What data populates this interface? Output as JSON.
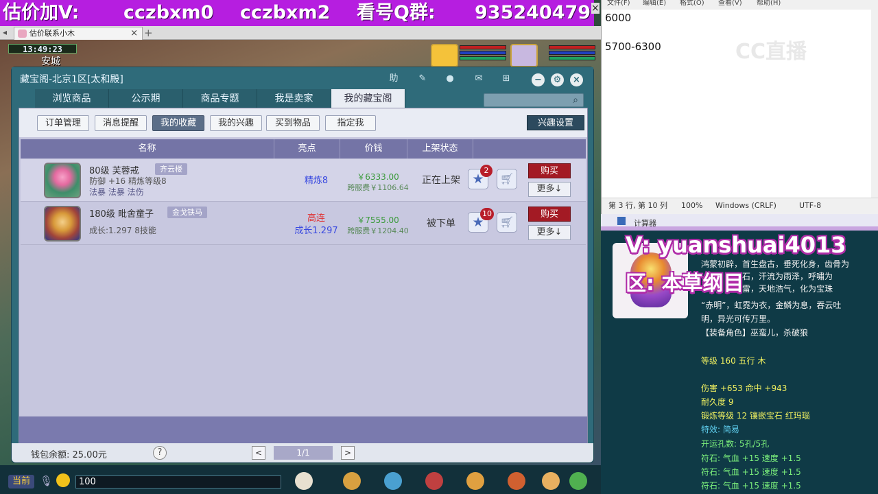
{
  "stream_banner": {
    "text_1": "估价加V:",
    "text_2": "cczbxm0",
    "text_3": "cczbxm2",
    "text_4": "看号Q群:",
    "text_5": "935240479",
    "close": "×"
  },
  "browser": {
    "tab_title": "估价联系小木",
    "tab_close": "×",
    "new_tab": "+"
  },
  "game_hud": {
    "time": "13:49:23",
    "city": "安城"
  },
  "shop": {
    "title": "藏宝阁-北京1区[太和殿]",
    "toolbar": {
      "help": "助"
    },
    "tabs": [
      {
        "label": "浏览商品"
      },
      {
        "label": "公示期"
      },
      {
        "label": "商品专题"
      },
      {
        "label": "我是卖家"
      },
      {
        "label": "我的藏宝阁"
      }
    ],
    "search_placeholder": "",
    "subtabs": [
      {
        "label": "订单管理"
      },
      {
        "label": "消息提醒"
      },
      {
        "label": "我的收藏"
      },
      {
        "label": "我的兴趣"
      },
      {
        "label": "买到物品"
      },
      {
        "label": "指定我"
      }
    ],
    "interest_settings": "兴趣设置",
    "columns": {
      "name": "名称",
      "highlight": "亮点",
      "price": "价钱",
      "status": "上架状态"
    },
    "items": [
      {
        "name": "80级 芙蓉戒",
        "tag": "齐云楼",
        "desc_1": "防御 +16 精炼等级8",
        "desc_2": "法暴 法暴 法伤",
        "highlight_1": "精炼8",
        "highlight_2": "",
        "price": "￥6333.00",
        "cross_price": "跨服费￥1106.64",
        "status": "正在上架",
        "fav_count": "2",
        "buy": "购买",
        "more": "更多↓"
      },
      {
        "name": "180级 毗舍童子",
        "tag": "金戈铁马",
        "desc_1": "成长:1.297 8技能",
        "desc_2": "",
        "highlight_1": "高连",
        "highlight_2": "成长1.297",
        "price": "￥7555.00",
        "cross_price": "跨服费￥1204.40",
        "status": "被下单",
        "fav_count": "10",
        "buy": "购买",
        "more": "更多↓"
      }
    ],
    "wallet": "钱包余额: 25.00元",
    "help": "?",
    "prev": "<",
    "page": "1/1",
    "next": ">"
  },
  "bottom_bar": {
    "channel": "当前",
    "chat_value": "100"
  },
  "notepad": {
    "menu": [
      "文件(F)",
      "编辑(E)",
      "格式(O)",
      "查看(V)",
      "帮助(H)"
    ],
    "line_1": "6000",
    "line_2": "5700-6300",
    "status_pos": "第 3 行, 第 10 列",
    "status_zoom": "100%",
    "status_eol": "Windows (CRLF)",
    "status_enc": "UTF-8"
  },
  "watermark": "CC直播",
  "calculator": {
    "title": "计算器"
  },
  "item_panel": {
    "overlay_v": "V: yuanshuai4013",
    "overlay_zone": "区: 本草纲目",
    "lore_1": "鸿蒙初辟，首生盘古，垂死化身，齿骨为",
    "lore_2": "金石，汗流为雨泽，呼嘯为",
    "lore_3": "风雷，天地浩气，化为宝珠",
    "lore_4": "“赤明”，虹霓为衣，金鳞为息，吞云吐",
    "lore_5": "明，异光可传万里。",
    "role": "【装备角色】巫蛮儿，杀破狼",
    "level": "等级 160 五行 木",
    "dmg": "伤害 +653 命中 +943",
    "durability": "耐久度 9",
    "forge": "锻炼等级 12 镶嵌宝石 红玛瑙",
    "effect": "特效: 简易",
    "holes": "开运孔数: 5孔/5孔",
    "rune_1": "符石: 气血 +15 速度 +1.5",
    "rune_2": "符石: 气血 +15 速度 +1.5",
    "rune_3": "符石: 气血 +15 速度 +1.5"
  },
  "colors": {
    "banner": "#b61ee0",
    "shop_frame": "#2f6b7a",
    "buy_button": "#a31a24",
    "price_green": "#3a9a3a",
    "highlight_red": "#e03030",
    "highlight_blue": "#3a4ae0",
    "attr_green": "#7cf07c"
  }
}
